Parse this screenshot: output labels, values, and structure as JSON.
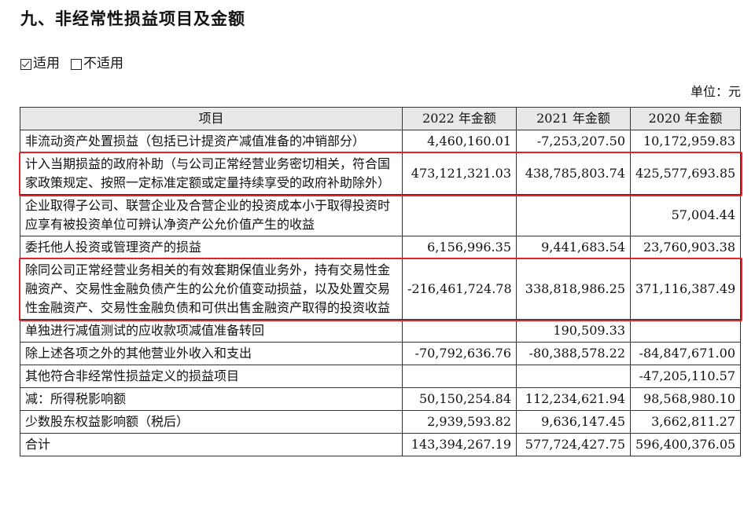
{
  "title": "九、非经常性损益项目及金额",
  "applicability": {
    "applicable": "适用",
    "not_applicable": "不适用"
  },
  "unit": "单位：元",
  "table": {
    "headers": [
      "项目",
      "2022 年金额",
      "2021 年金额",
      "2020 年金额"
    ],
    "rows": [
      {
        "item": "非流动资产处置损益（包括已计提资产减值准备的冲销部分）",
        "v2022": "4,460,160.01",
        "v2021": "-7,253,207.50",
        "v2020": "10,172,959.83"
      },
      {
        "item": "计入当期损益的政府补助（与公司正常经营业务密切相关，符合国家政策规定、按照一定标准定额或定量持续享受的政府补助除外）",
        "v2022": "473,121,321.03",
        "v2021": "438,785,803.74",
        "v2020": "425,577,693.85"
      },
      {
        "item": "企业取得子公司、联营企业及合营企业的投资成本小于取得投资时应享有被投资单位可辨认净资产公允价值产生的收益",
        "v2022": "",
        "v2021": "",
        "v2020": "57,004.44"
      },
      {
        "item": "委托他人投资或管理资产的损益",
        "v2022": "6,156,996.35",
        "v2021": "9,441,683.54",
        "v2020": "23,760,903.38"
      },
      {
        "item": "除同公司正常经营业务相关的有效套期保值业务外，持有交易性金融资产、交易性金融负债产生的公允价值变动损益，以及处置交易性金融资产、交易性金融负债和可供出售金融资产取得的投资收益",
        "v2022": "-216,461,724.78",
        "v2021": "338,818,986.25",
        "v2020": "371,116,387.49"
      },
      {
        "item": "单独进行减值测试的应收款项减值准备转回",
        "v2022": "",
        "v2021": "190,509.33",
        "v2020": ""
      },
      {
        "item": "除上述各项之外的其他营业外收入和支出",
        "v2022": "-70,792,636.76",
        "v2021": "-80,388,578.22",
        "v2020": "-84,847,671.00"
      },
      {
        "item": "其他符合非经常性损益定义的损益项目",
        "v2022": "",
        "v2021": "",
        "v2020": "-47,205,110.57"
      },
      {
        "item": "减：所得税影响额",
        "v2022": "50,150,254.84",
        "v2021": "112,234,621.94",
        "v2020": "98,568,980.10"
      },
      {
        "item": "少数股东权益影响额（税后）",
        "v2022": "2,939,593.82",
        "v2021": "9,636,147.45",
        "v2020": "3,662,811.27"
      },
      {
        "item": "合计",
        "v2022": "143,394,267.19",
        "v2021": "577,724,427.75",
        "v2020": "596,400,376.05"
      }
    ]
  },
  "colors": {
    "highlight": "#e8202a",
    "header_bg": "#e8e8e8"
  }
}
